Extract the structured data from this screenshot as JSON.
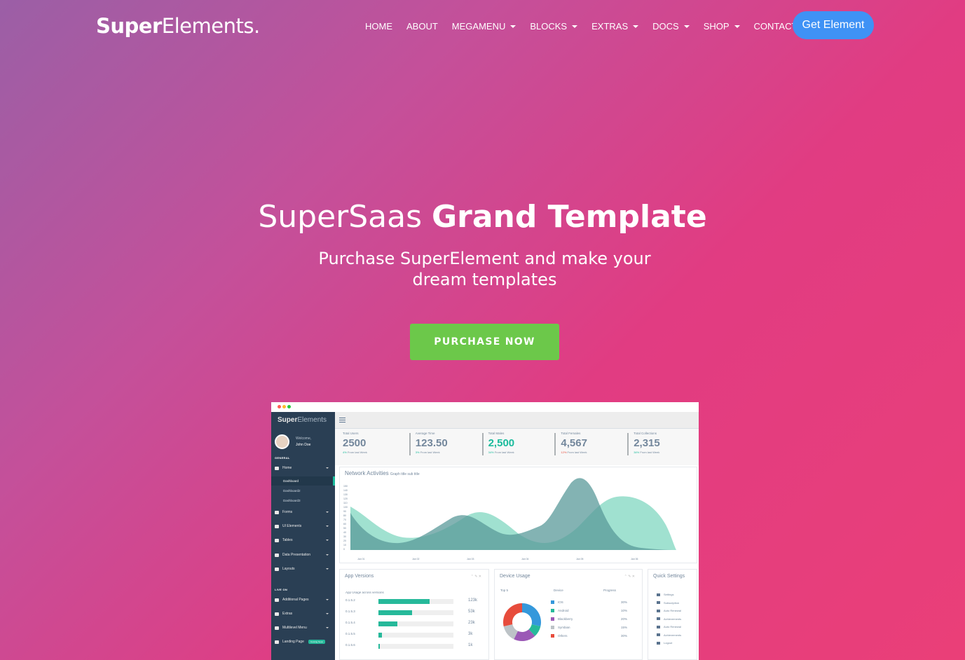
{
  "nav": {
    "brand_bold": "Super",
    "brand_light": "Elements.",
    "items": [
      {
        "label": "HOME",
        "dropdown": false
      },
      {
        "label": "ABOUT",
        "dropdown": false
      },
      {
        "label": "MEGAMENU",
        "dropdown": true
      },
      {
        "label": "BLOCKS",
        "dropdown": true
      },
      {
        "label": "EXTRAS",
        "dropdown": true
      },
      {
        "label": "DOCS",
        "dropdown": true
      },
      {
        "label": "SHOP",
        "dropdown": true
      },
      {
        "label": "CONTACT",
        "dropdown": false
      }
    ],
    "cta": "Get Element"
  },
  "hero": {
    "title_light": "SuperSaas",
    "title_bold": "Grand Template",
    "subtitle": "Purchase SuperElement and make your dream templates",
    "button": "PURCHASE NOW"
  },
  "colors": {
    "gradient_start": "#9b5fa6",
    "gradient_end": "#ea3f78",
    "cta_blue": "#3f92f5",
    "button_green": "#6cc84a",
    "sidebar": "#2a3f54",
    "accent_teal": "#1abb9c"
  },
  "mockup": {
    "logo_bold": "Super",
    "logo_light": "Elements",
    "welcome": "Welcome,",
    "user": "John Doe",
    "section_general": "GENERAL",
    "section_live": "LIVE ON",
    "menu": [
      {
        "label": "Home",
        "icon": "home-icon"
      },
      {
        "label": "Forms",
        "icon": "edit-icon"
      },
      {
        "label": "UI Elements",
        "icon": "desktop-icon"
      },
      {
        "label": "Tables",
        "icon": "table-icon"
      },
      {
        "label": "Data Presentation",
        "icon": "bar-chart-icon"
      },
      {
        "label": "Layouts",
        "icon": "clone-icon"
      }
    ],
    "submenu": [
      "Dashboard",
      "Dashboard2",
      "Dashboard3"
    ],
    "menu_live": [
      {
        "label": "Additional Pages",
        "icon": "bug-icon"
      },
      {
        "label": "Extras",
        "icon": "windows-icon"
      },
      {
        "label": "Multilevel Menu",
        "icon": "sitemap-icon"
      },
      {
        "label": "Landing Page",
        "icon": "laptop-icon",
        "badge": "Coming Soon"
      }
    ],
    "stats": [
      {
        "label": "Total Users",
        "value": "2500",
        "change_pct": "4%",
        "change_text": "From last Week",
        "trend": "up",
        "green": false
      },
      {
        "label": "Average Time",
        "value": "123.50",
        "change_pct": "3%",
        "change_text": "From last Week",
        "trend": "up",
        "green": false
      },
      {
        "label": "Total Males",
        "value": "2,500",
        "change_pct": "34%",
        "change_text": "From last Week",
        "trend": "up",
        "green": true
      },
      {
        "label": "Total Females",
        "value": "4,567",
        "change_pct": "12%",
        "change_text": "From last Week",
        "trend": "down",
        "green": false
      },
      {
        "label": "Total Collections",
        "value": "2,315",
        "change_pct": "34%",
        "change_text": "From last Week",
        "trend": "up",
        "green": false
      }
    ],
    "network": {
      "title": "Network Activities",
      "subtitle": "Graph title sub title",
      "y_ticks": [
        "150",
        "140",
        "130",
        "120",
        "110",
        "100",
        "90",
        "80",
        "70",
        "60",
        "50",
        "40",
        "30",
        "20",
        "10",
        "0"
      ],
      "x_ticks": [
        "Jan 01",
        "Jan 02",
        "Jan 03",
        "Jan 04",
        "Jan 05",
        "Jan 06"
      ]
    },
    "app_versions": {
      "title": "App Versions",
      "subtitle": "App Usage across versions",
      "rows": [
        {
          "version": "0.1.5.2",
          "pct": 68,
          "value": "123k"
        },
        {
          "version": "0.1.5.3",
          "pct": 45,
          "value": "53k"
        },
        {
          "version": "0.1.5.4",
          "pct": 25,
          "value": "23k"
        },
        {
          "version": "0.1.5.5",
          "pct": 5,
          "value": "3k"
        },
        {
          "version": "0.1.5.6",
          "pct": 2,
          "value": "1k"
        }
      ]
    },
    "device_usage": {
      "title": "Device Usage",
      "top_label": "Top 5",
      "col_device": "Device",
      "col_progress": "Progress",
      "rows": [
        {
          "name": "IOS",
          "value": "30%",
          "color": "#3498db"
        },
        {
          "name": "Android",
          "value": "10%",
          "color": "#26b99a"
        },
        {
          "name": "Blackberry",
          "value": "20%",
          "color": "#9b59b6"
        },
        {
          "name": "Symbian",
          "value": "15%",
          "color": "#bdc3c7"
        },
        {
          "name": "Others",
          "value": "30%",
          "color": "#e74c3c"
        }
      ]
    },
    "quick_settings": {
      "title": "Quick Settings",
      "items": [
        "Settings",
        "Subscription",
        "Auto Renewal",
        "Achievements",
        "Auto Renewal",
        "Achievements",
        "Logout"
      ]
    }
  }
}
